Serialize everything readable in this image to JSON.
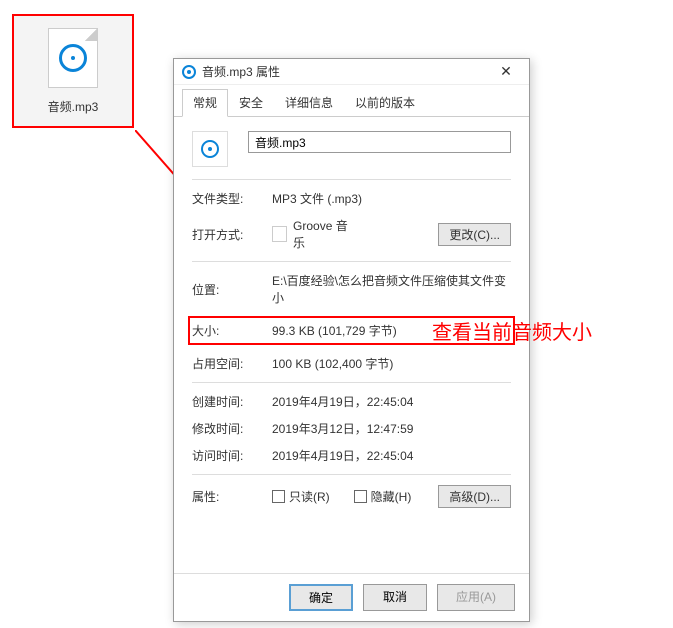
{
  "file_icon": {
    "filename": "音频.mp3"
  },
  "dialog": {
    "title": "音频.mp3 属性",
    "tabs": {
      "general": "常规",
      "security": "安全",
      "details": "详细信息",
      "previous": "以前的版本"
    },
    "filename_value": "音频.mp3",
    "rows": {
      "filetype_label": "文件类型:",
      "filetype_value": "MP3 文件 (.mp3)",
      "openwith_label": "打开方式:",
      "openwith_value": "Groove 音乐",
      "change_btn": "更改(C)...",
      "location_label": "位置:",
      "location_value": "E:\\百度经验\\怎么把音频文件压缩使其文件变小",
      "size_label": "大小:",
      "size_value": "99.3 KB (101,729 字节)",
      "sizedisk_label": "占用空间:",
      "sizedisk_value": "100 KB (102,400 字节)",
      "created_label": "创建时间:",
      "created_value": "2019年4月19日，22:45:04",
      "modified_label": "修改时间:",
      "modified_value": "2019年3月12日，12:47:59",
      "accessed_label": "访问时间:",
      "accessed_value": "2019年4月19日，22:45:04",
      "attr_label": "属性:",
      "readonly_label": "只读(R)",
      "hidden_label": "隐藏(H)",
      "advanced_btn": "高级(D)..."
    },
    "buttons": {
      "ok": "确定",
      "cancel": "取消",
      "apply": "应用(A)"
    }
  },
  "annotation": "查看当前音频大小"
}
